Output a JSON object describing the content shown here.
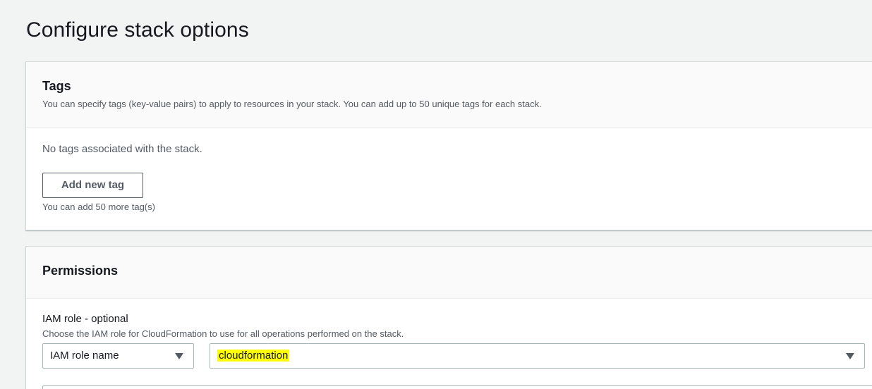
{
  "page": {
    "title": "Configure stack options"
  },
  "tags": {
    "heading": "Tags",
    "description": "You can specify tags (key-value pairs) to apply to resources in your stack. You can add up to 50 unique tags for each stack.",
    "empty_text": "No tags associated with the stack.",
    "add_button_label": "Add new tag",
    "remaining_hint": "You can add 50 more tag(s)"
  },
  "permissions": {
    "heading": "Permissions",
    "iam_role": {
      "label": "IAM role - optional",
      "description": "Choose the IAM role for CloudFormation to use for all operations performed on the stack.",
      "type_selected": "IAM role name",
      "value_selected": "cloudformation"
    }
  },
  "colors": {
    "page_background": "#f2f3f3",
    "panel_header_background": "#fafafa",
    "text_primary": "#16191f",
    "text_secondary": "#545b64",
    "highlight": "#ffff00"
  }
}
